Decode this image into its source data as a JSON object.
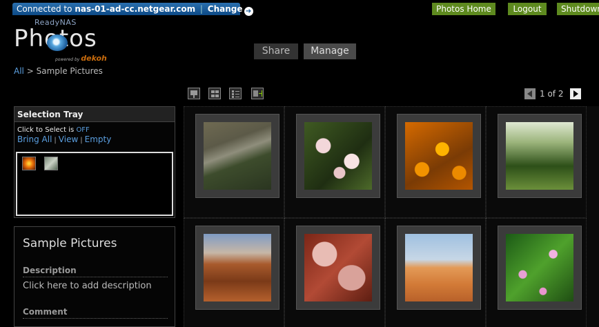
{
  "topbar": {
    "connected_prefix": "Connected to",
    "host": "nas-01-ad-cc.netgear.com",
    "change_label": "Change",
    "buttons": {
      "photos_home": "Photos Home",
      "logout": "Logout",
      "shutdown": "Shutdown"
    }
  },
  "logo": {
    "brand": "ReadyNAS",
    "product": "Photos",
    "powered_prefix": "powered by",
    "powered_brand": "dekoh"
  },
  "tabs": [
    "Share",
    "Manage"
  ],
  "breadcrumb": {
    "root": "All",
    "separator": ">",
    "current": "Sample Pictures"
  },
  "toolbar": {
    "icons": [
      "slideshow-icon",
      "grid-view-icon",
      "list-view-icon",
      "fit-view-icon"
    ]
  },
  "pager": {
    "text": "1 of 2"
  },
  "tray": {
    "title": "Selection Tray",
    "select_label": "Click to Select is",
    "select_value": "OFF",
    "links": [
      "Bring All",
      "View",
      "Empty"
    ]
  },
  "info": {
    "title": "Sample Pictures",
    "description_label": "Description",
    "description_text": "Click here to add description",
    "comment_label": "Comment"
  },
  "colors": {
    "accent_blue": "#5b9fe0",
    "nav_green": "#5e8a1f",
    "connect_blue": "#1a5a98"
  }
}
